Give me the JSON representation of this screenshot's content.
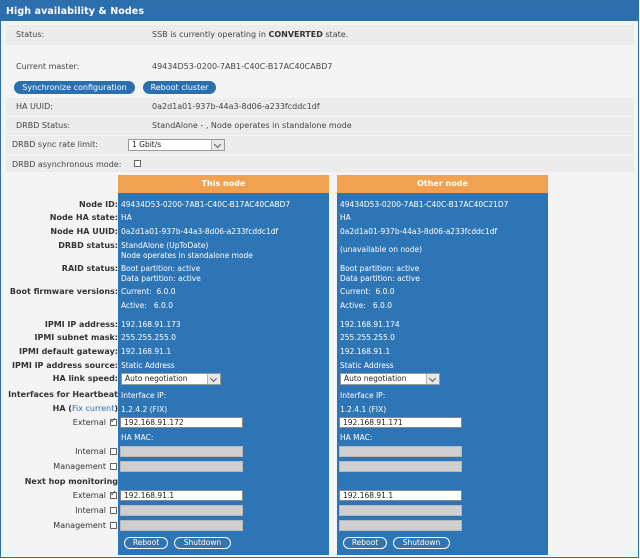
{
  "header": {
    "title": "High availability & Nodes"
  },
  "status": {
    "label": "Status:",
    "text_pre": "SSB is currently operating in ",
    "text_bold": "CONVERTED",
    "text_post": " state."
  },
  "current_master": {
    "label": "Current master:",
    "value": "49434D53-0200-7AB1-C40C-B17AC40CABD7"
  },
  "buttons": {
    "sync": "Synchronize configuration",
    "reboot_cluster": "Reboot cluster"
  },
  "ha_uuid": {
    "label": "HA UUID:",
    "value": "0a2d1a01-937b-44a3-8d06-a233fcddc1df"
  },
  "drbd_status": {
    "label": "DRBD Status:",
    "value": "StandAlone - , Node operates in standalone mode"
  },
  "drbd_sync_rate": {
    "label": "DRBD sync rate limit:",
    "value": "1 Gbit/s"
  },
  "drbd_async": {
    "label": "DRBD asynchronous mode:"
  },
  "labels": {
    "node_id": "Node ID:",
    "node_ha_state": "Node HA state:",
    "node_ha_uuid": "Node HA UUID:",
    "drbd_status": "DRBD status:",
    "raid_status": "RAID status:",
    "boot_firmware": "Boot firmware versions:",
    "ipmi_ip": "IPMI IP address:",
    "ipmi_subnet": "IPMI subnet mask:",
    "ipmi_gateway": "IPMI default gateway:",
    "ipmi_source": "IPMI IP address source:",
    "ha_link_speed": "HA link speed:",
    "interfaces_heartbeat": "Interfaces for Heartbeat",
    "ha_prefix": "HA (",
    "fix_current": "Fix current",
    "ha_suffix": ")",
    "external": "External",
    "internal": "Internal",
    "management": "Management",
    "next_hop": "Next hop monitoring"
  },
  "this_node": {
    "title": "This node",
    "node_id": "49434D53-0200-7AB1-C40C-B17AC40CABD7",
    "ha_state": "HA",
    "ha_uuid": "0a2d1a01-937b-44a3-8d06-a233fcddc1df",
    "drbd_line1": "StandAlone (UpToDate)",
    "drbd_line2": "Node operates in standalone mode",
    "raid_line1": "Boot partition: active",
    "raid_line2": "Data partition: active",
    "fw_current": "Current:  6.0.0",
    "fw_active": "Active:   6.0.0",
    "ipmi_ip": "192.168.91.173",
    "ipmi_subnet": "255.255.255.0",
    "ipmi_gateway": "192.168.91.1",
    "ipmi_source": "Static Address",
    "link_speed": "Auto negotiation",
    "interface_ip_label": "Interface IP:",
    "interface_ip": "1.2.4.2 (FIX)",
    "external_ip": "192.168.91.172",
    "ha_mac_label": "HA MAC:",
    "next_hop_external": "192.168.91.1",
    "reboot": "Reboot",
    "shutdown": "Shutdown"
  },
  "other_node": {
    "title": "Other node",
    "node_id": "49434D53-0200-7AB1-C40C-B17AC40C21D7",
    "ha_state": "HA",
    "ha_uuid": "0a2d1a01-937b-44a3-8d06-a233fcddc1df",
    "drbd_line1": "(unavailable on node)",
    "raid_line1": "Boot partition: active",
    "raid_line2": "Data partition: active",
    "fw_current": "Current:  6.0.0",
    "fw_active": "Active:   6.0.0",
    "ipmi_ip": "192.168.91.174",
    "ipmi_subnet": "255.255.255.0",
    "ipmi_gateway": "192.168.91.1",
    "ipmi_source": "Static Address",
    "link_speed": "Auto negotiation",
    "interface_ip_label": "Interface IP:",
    "interface_ip": "1.2.4.1 (FIX)",
    "external_ip": "192.168.91.171",
    "ha_mac_label": "HA MAC:",
    "next_hop_external": "192.168.91.1",
    "reboot": "Reboot",
    "shutdown": "Shutdown"
  },
  "colors": {
    "header": "#2c6fae",
    "node_body": "#2e75b6",
    "node_head": "#f0a250"
  }
}
